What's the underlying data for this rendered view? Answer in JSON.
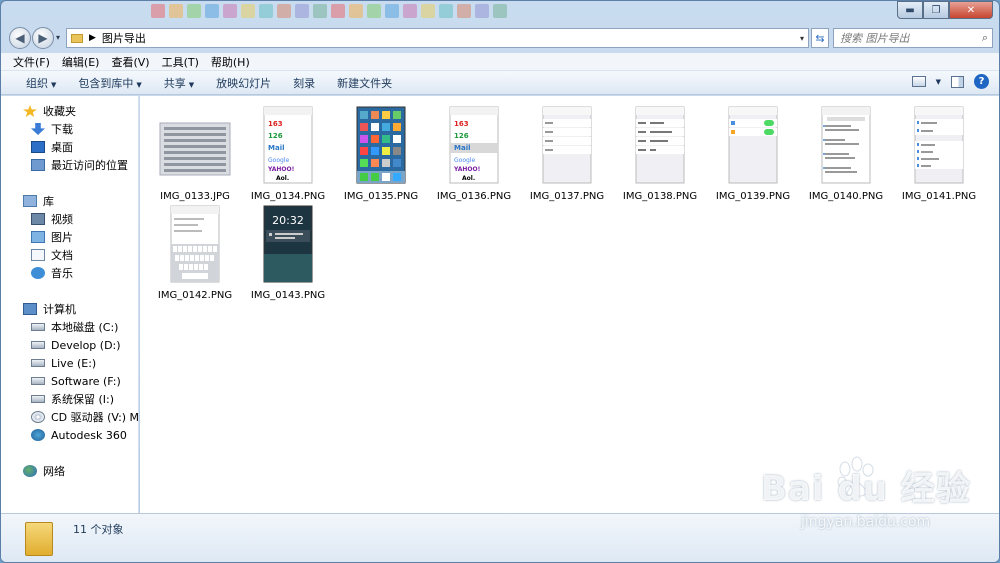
{
  "address": {
    "path": "图片导出",
    "search_placeholder": "搜索 图片导出"
  },
  "menu": [
    "文件(F)",
    "编辑(E)",
    "查看(V)",
    "工具(T)",
    "帮助(H)"
  ],
  "toolbar": {
    "organize": "组织",
    "include": "包含到库中",
    "share": "共享",
    "slideshow": "放映幻灯片",
    "burn": "刻录",
    "new_folder": "新建文件夹"
  },
  "nav": {
    "favorites": "收藏夹",
    "downloads": "下载",
    "desktop": "桌面",
    "recent": "最近访问的位置",
    "libraries": "库",
    "videos": "视频",
    "pictures": "图片",
    "documents": "文档",
    "music": "音乐",
    "computer": "计算机",
    "drives": [
      "本地磁盘 (C:)",
      "Develop (D:)",
      "Live (E:)",
      "Software (F:)",
      "系统保留 (I:)",
      "CD 驱动器 (V:) METT"
    ],
    "autodesk": "Autodesk 360",
    "network": "网络"
  },
  "files": [
    {
      "name": "IMG_0133.JPG",
      "thumb_text": ""
    },
    {
      "name": "IMG_0134.PNG",
      "thumb_text": "163 126 Mail Google YAHOO! Aol."
    },
    {
      "name": "IMG_0135.PNG",
      "thumb_text": ""
    },
    {
      "name": "IMG_0136.PNG",
      "thumb_text": "163 126 Mail Google YAHOO! Aol."
    },
    {
      "name": "IMG_0137.PNG",
      "thumb_text": ""
    },
    {
      "name": "IMG_0138.PNG",
      "thumb_text": ""
    },
    {
      "name": "IMG_0139.PNG",
      "thumb_text": ""
    },
    {
      "name": "IMG_0140.PNG",
      "thumb_text": ""
    },
    {
      "name": "IMG_0141.PNG",
      "thumb_text": ""
    },
    {
      "name": "IMG_0142.PNG",
      "thumb_text": ""
    },
    {
      "name": "IMG_0143.PNG",
      "thumb_text": "20:32"
    }
  ],
  "status": {
    "count": "11 个对象"
  },
  "watermark": {
    "brand": "Bai du 经验",
    "url": "jingyan.baidu.com"
  },
  "colors": {
    "accent": "#1e395b",
    "help": "#1f66c4",
    "close": "#c7452f"
  }
}
